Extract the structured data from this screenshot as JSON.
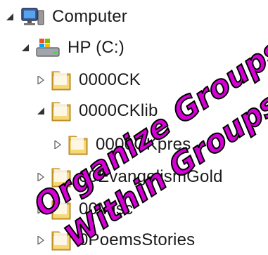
{
  "tree": {
    "computer": {
      "label": "Computer"
    },
    "drive": {
      "label": "HP (C:)"
    },
    "folders": [
      {
        "label": "0000CK"
      },
      {
        "label": "0000CKlib"
      },
      {
        "label": "0000CKpres"
      },
      {
        "label": "00EvangelismGold"
      },
      {
        "label": "00Misc"
      },
      {
        "label": "0PoemsStories"
      }
    ]
  },
  "overlay": {
    "line1": "Organize Groups",
    "line2": "Within Groups"
  },
  "colors": {
    "overlay_fill": "#d400d4",
    "overlay_stroke": "#000000",
    "folder_yellow": "#f2c84b"
  }
}
